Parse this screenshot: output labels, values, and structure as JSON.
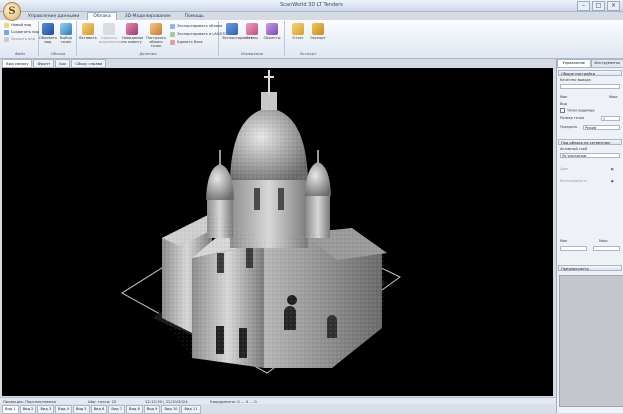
{
  "app": {
    "title": "ScanWorld 3D LT Tenders",
    "logo_letter": "S",
    "window_buttons": [
      "–",
      "□",
      "×"
    ]
  },
  "ribbon_tabs": [
    {
      "label": "Управление данными",
      "active": false
    },
    {
      "label": "Облака",
      "active": true
    },
    {
      "label": "3D-Моделирование",
      "active": false
    },
    {
      "label": "Помощь",
      "active": false
    }
  ],
  "ribbon": {
    "groups": [
      {
        "label": "Файл",
        "small_buttons": [
          "Новый вид",
          "Сохранить вид",
          "Закрыть вид"
        ]
      },
      {
        "label": "Облака",
        "buttons": [
          "Обновить вид",
          "Выбор точек"
        ]
      },
      {
        "label": "Деление",
        "buttons": [
          "Вставить",
          "Удалить выделенные",
          "Невидимое по лимиту",
          "Построить облако точек"
        ],
        "small_buttons": [
          "Экспортировать облака",
          "Экспортировать в LAS/E57",
          "Удалить блок"
        ]
      },
      {
        "label": "Измерения",
        "buttons": [
          "Экспортировать",
          "Стены",
          "Объекты"
        ]
      },
      {
        "label": "Экспорт",
        "buttons": [
          "Отчет",
          "Экспорт"
        ]
      }
    ]
  },
  "doc_tabs": [
    {
      "label": "Вид сверху",
      "active": true
    },
    {
      "label": "Фронт",
      "active": false
    },
    {
      "label": "Бок",
      "active": false
    },
    {
      "label": "Сбоку справа",
      "active": false
    }
  ],
  "status": {
    "mode": "Проекция: Перспективная",
    "points": "Шаг точки: 25",
    "time": "12:12:30 | 22/10/2024",
    "coords": "Координаты: 0 ... 0 ... 0"
  },
  "bottom_tabs": [
    {
      "label": "Вид 1",
      "active": true
    },
    {
      "label": "Вид 2",
      "active": false
    },
    {
      "label": "Вид 3",
      "active": false
    },
    {
      "label": "Вид 4",
      "active": false
    },
    {
      "label": "Вид 5",
      "active": false
    },
    {
      "label": "Вид 6",
      "active": false
    },
    {
      "label": "Вид 7",
      "active": false
    },
    {
      "label": "Вид 8",
      "active": false
    },
    {
      "label": "Вид 9",
      "active": false
    },
    {
      "label": "Вид 10",
      "active": false
    },
    {
      "label": "Вид 11",
      "active": false
    }
  ],
  "right_panel": {
    "tabs": [
      {
        "label": "Управление",
        "active": true
      },
      {
        "label": "Инструменты",
        "active": false
      }
    ],
    "section1": {
      "title": "Общие настройки",
      "rows": [
        "Качество вывода",
        "Вид",
        "Точки видимые",
        "Размер точки",
        "Прозрачн."
      ],
      "fields": {
        "point_size": "1",
        "transparency": "Режим",
        "quality_min": "Мин",
        "quality_max": "Макс"
      }
    },
    "section2": {
      "title": "Под облака по сегментам",
      "rows": [
        "Активный слой",
        "Цвет",
        "Интенсивность"
      ],
      "layer_value": "По умолчанию",
      "bottom_labels": [
        "Мин",
        "Макс"
      ]
    },
    "section3": {
      "title": "Предпросмотр"
    }
  },
  "colors": {
    "ribbon_bg": "#dfe7f2",
    "viewport_bg": "#000000",
    "accent": "#2a5da8"
  },
  "icons": {
    "logo": "app-logo",
    "model": "point-cloud-building"
  }
}
